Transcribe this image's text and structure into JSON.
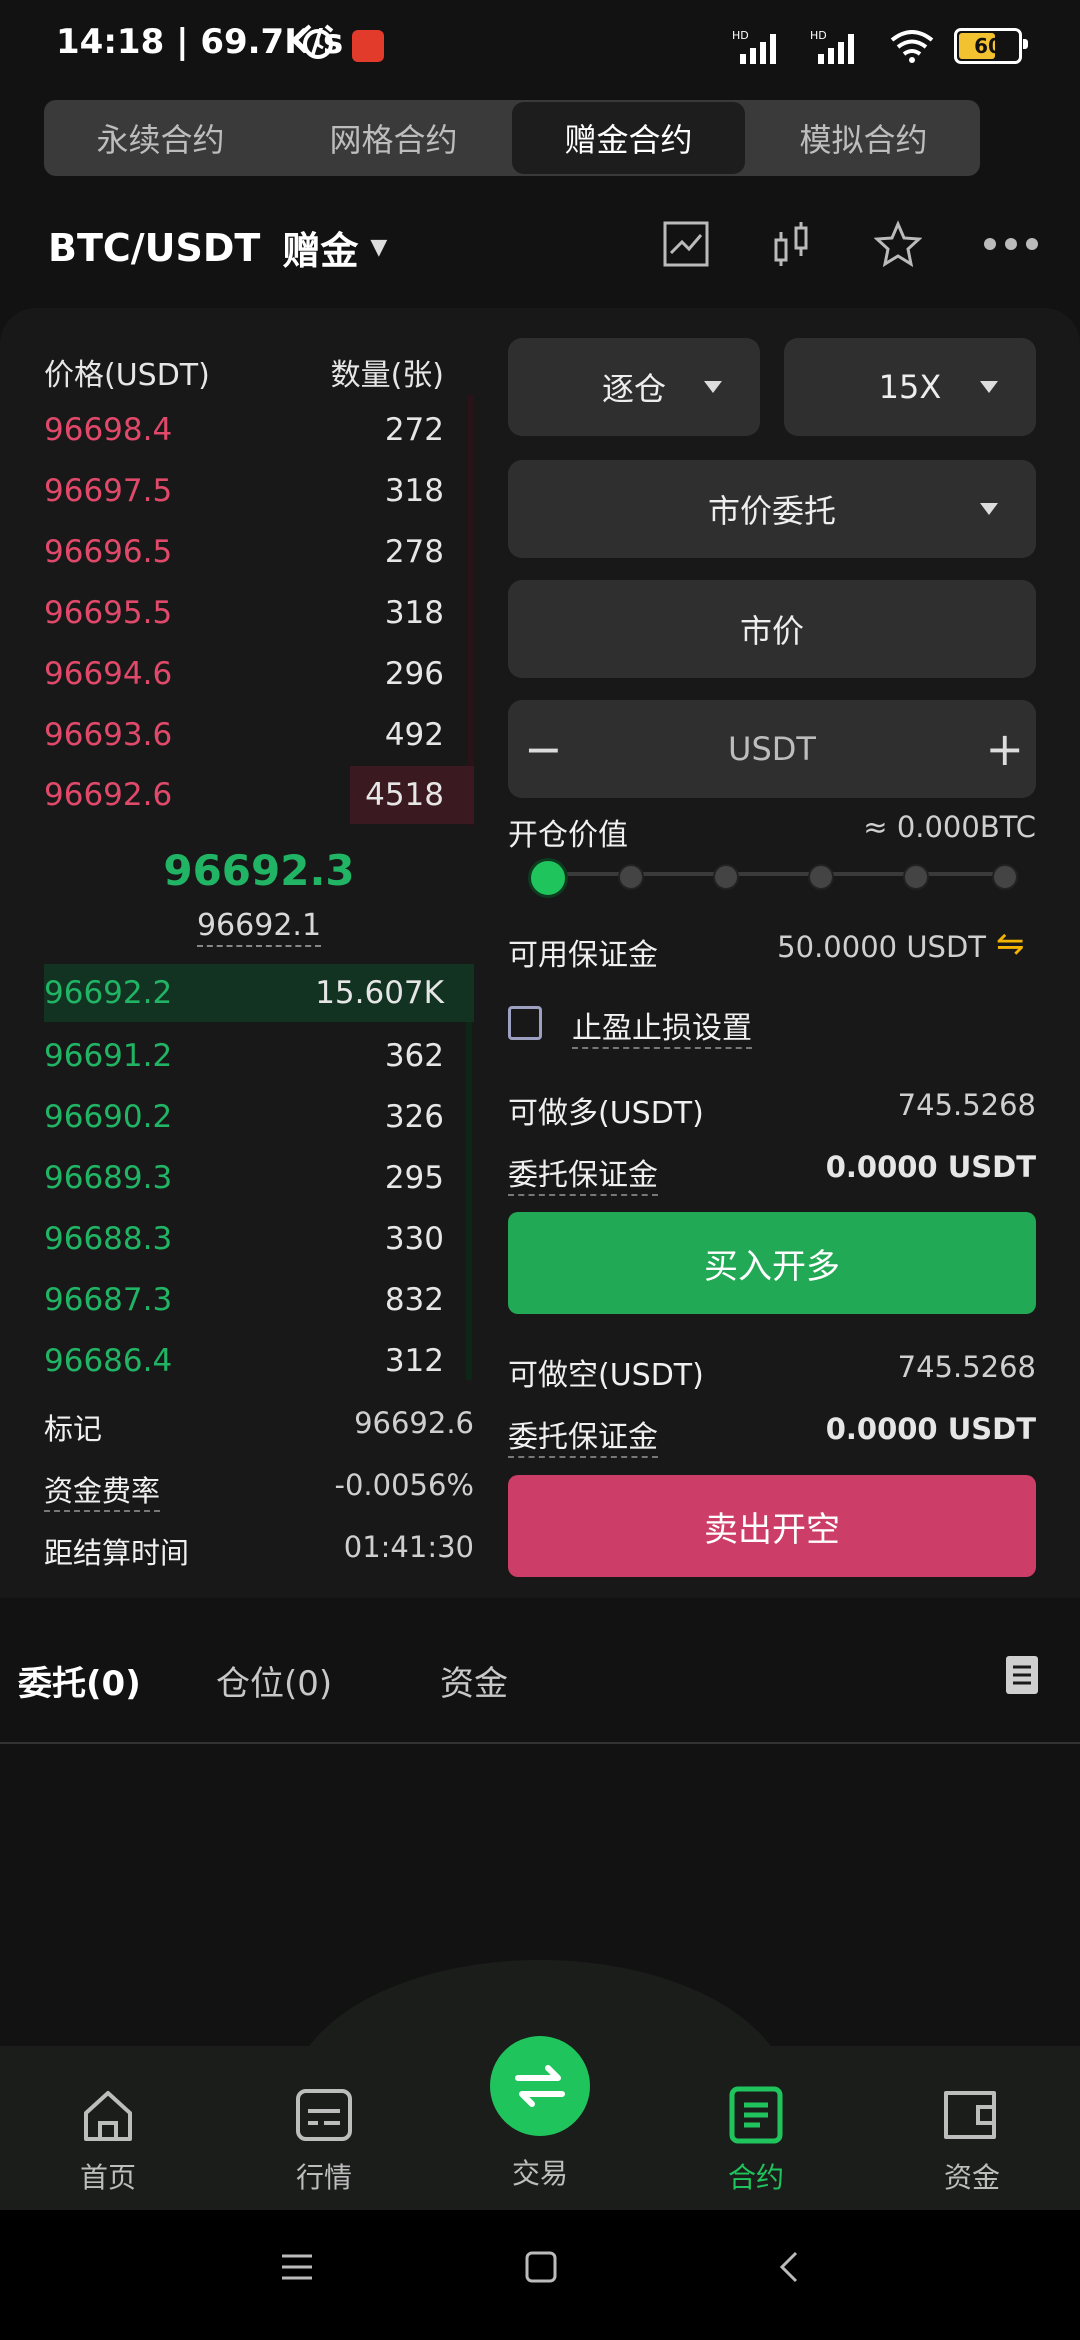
{
  "status_bar": {
    "time": "14:18 | 69.7K/s",
    "battery": "60"
  },
  "contract_tabs": [
    "永续合约",
    "网格合约",
    "赠金合约",
    "模拟合约"
  ],
  "active_tab_index": 2,
  "pair": {
    "symbol": "BTC/USDT",
    "mode": "赠金"
  },
  "order_book": {
    "price_header": "价格(USDT)",
    "qty_header": "数量(张)",
    "asks": [
      {
        "price": "96698.4",
        "qty": "272"
      },
      {
        "price": "96697.5",
        "qty": "318"
      },
      {
        "price": "96696.5",
        "qty": "278"
      },
      {
        "price": "96695.5",
        "qty": "318"
      },
      {
        "price": "96694.6",
        "qty": "296"
      },
      {
        "price": "96693.6",
        "qty": "492"
      },
      {
        "price": "96692.6",
        "qty": "4518"
      }
    ],
    "last_price": "96692.3",
    "mark_price_small": "96692.1",
    "bids": [
      {
        "price": "96692.2",
        "qty": "15.607K"
      },
      {
        "price": "96691.2",
        "qty": "362"
      },
      {
        "price": "96690.2",
        "qty": "326"
      },
      {
        "price": "96689.3",
        "qty": "295"
      },
      {
        "price": "96688.3",
        "qty": "330"
      },
      {
        "price": "96687.3",
        "qty": "832"
      },
      {
        "price": "96686.4",
        "qty": "312"
      }
    ],
    "info": [
      {
        "label": "标记",
        "value": "96692.6"
      },
      {
        "label": "资金费率",
        "value": "-0.0056%"
      },
      {
        "label": "距结算时间",
        "value": "01:41:30"
      }
    ]
  },
  "form": {
    "margin_mode": "逐仓",
    "leverage": "15X",
    "order_type": "市价委托",
    "price_field": "市价",
    "amount_unit": "USDT",
    "minus": "−",
    "plus": "+",
    "open_value_label": "开仓价值",
    "open_value": "≈ 0.000BTC",
    "available_label": "可用保证金",
    "available_value": "50.0000 USDT",
    "tpsl_label": "止盈止损设置",
    "long_label": "可做多(USDT)",
    "long_value": "745.5268",
    "margin_label_1": "委托保证金",
    "margin_value_1": "0.0000 USDT",
    "buy_button": "买入开多",
    "short_label": "可做空(USDT)",
    "short_value": "745.5268",
    "margin_label_2": "委托保证金",
    "margin_value_2": "0.0000 USDT",
    "sell_button": "卖出开空"
  },
  "bottom_tabs": [
    "委托(0)",
    "仓位(0)",
    "资金"
  ],
  "nav": [
    {
      "label": "首页",
      "icon": "home-icon"
    },
    {
      "label": "行情",
      "icon": "market-icon"
    },
    {
      "label": "交易",
      "icon": "swap-icon"
    },
    {
      "label": "合约",
      "icon": "contract-icon"
    },
    {
      "label": "资金",
      "icon": "wallet-icon"
    }
  ],
  "colors": {
    "ask": "#e0496a",
    "bid": "#20b464",
    "buy": "#22a955",
    "sell": "#cc3e68",
    "accent": "#20c45c"
  }
}
